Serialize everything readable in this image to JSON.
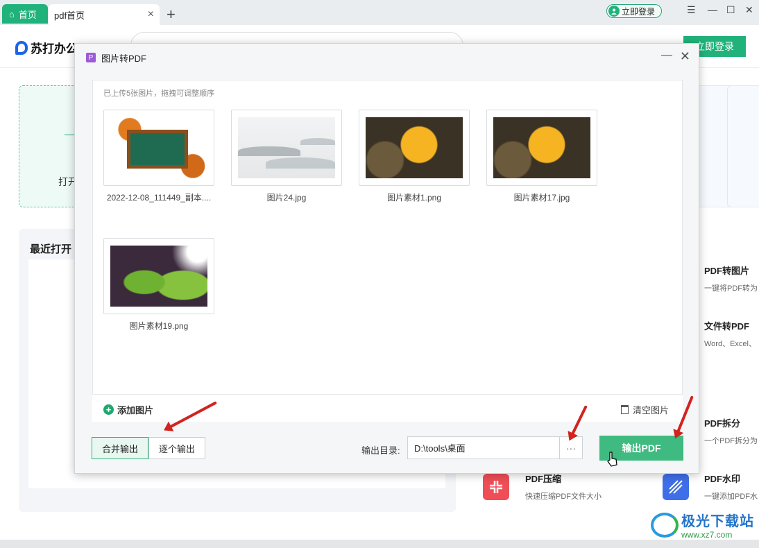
{
  "tabs": {
    "home": "首页",
    "active": "pdf首页"
  },
  "topbar": {
    "login": "立即登录"
  },
  "header": {
    "logo": "苏打办公",
    "login_btn": "立即登录"
  },
  "background": {
    "open_card": "打开",
    "recent_title": "最近打开",
    "features": [
      {
        "title": "PDF转图片",
        "desc": "一键将PDF转为"
      },
      {
        "title": "文件转PDF",
        "desc": "Word、Excel、"
      },
      {
        "title": "PDF拆分",
        "desc": "一个PDF拆分为"
      },
      {
        "title": "PDF压缩",
        "desc": "快速压缩PDF文件大小"
      },
      {
        "title": "PDF水印",
        "desc": "一键添加PDF水"
      }
    ]
  },
  "dialog": {
    "title": "图片转PDF",
    "hint": "已上传5张图片，拖拽可调整顺序",
    "images": [
      {
        "name": "2022-12-08_111449_副本.png",
        "display": "2022-12-08_111449_副本....",
        "thumb": "chalkboard"
      },
      {
        "name": "图片24.jpg",
        "display": "图片24.jpg",
        "thumb": "mist"
      },
      {
        "name": "图片素材1.png",
        "display": "图片素材1.png",
        "thumb": "leaf"
      },
      {
        "name": "图片素材17.jpg",
        "display": "图片素材17.jpg",
        "thumb": "leaf"
      },
      {
        "name": "图片素材19.png",
        "display": "图片素材19.png",
        "thumb": "green"
      }
    ],
    "add_images": "添加图片",
    "clear_images": "清空图片",
    "merge_output": "合并输出",
    "single_output": "逐个输出",
    "output_dir_label": "输出目录:",
    "output_dir_value": "D:\\tools\\桌面",
    "more": "···",
    "export_btn": "输出PDF"
  },
  "watermark": {
    "name": "极光下载站",
    "url": "www.xz7.com"
  },
  "colors": {
    "accent": "#20b27a",
    "export": "#3fba80",
    "arrow": "#d2231f"
  }
}
